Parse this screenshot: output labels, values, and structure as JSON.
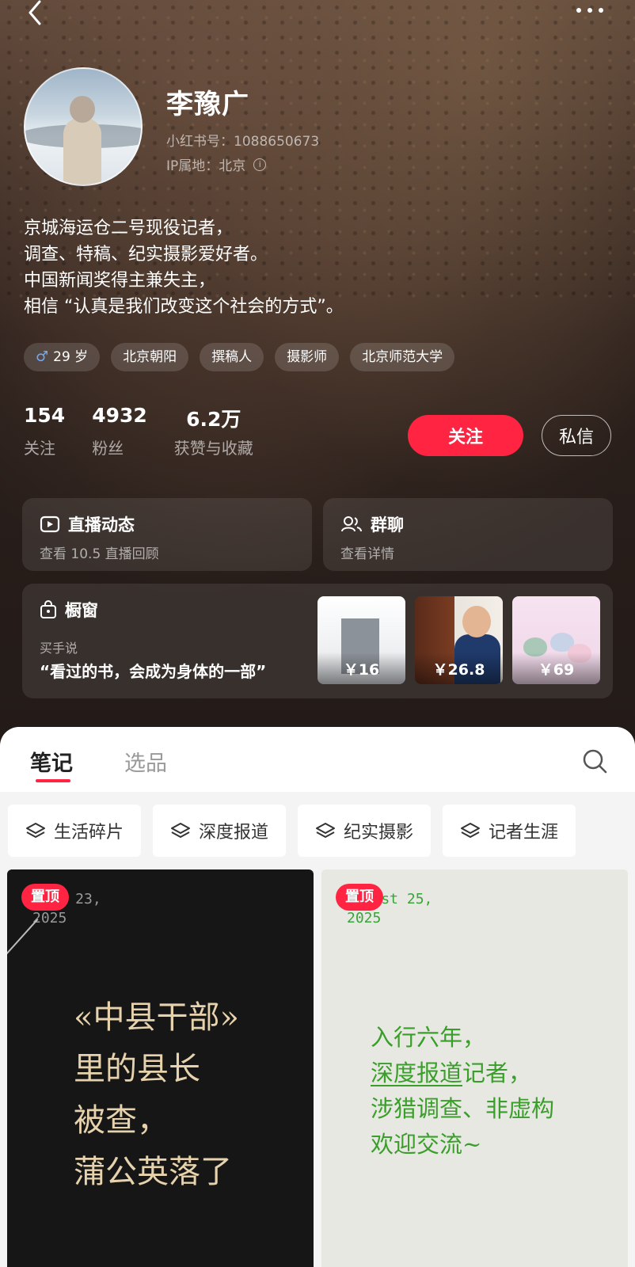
{
  "profile": {
    "name": "李豫广",
    "red_id": "小红书号：1088650673",
    "ip_location": "IP属地：北京",
    "bio_lines": [
      "京城海运仓二号现役记者，",
      "调查、特稿、纪实摄影爱好者。",
      "中国新闻奖得主兼失主，",
      "相信 “认真是我们改变这个社会的方式”。"
    ],
    "tags": [
      "29 岁",
      "北京朝阳",
      "撰稿人",
      "摄影师",
      "北京师范大学"
    ]
  },
  "stats": [
    {
      "value": "154",
      "label": "关注"
    },
    {
      "value": "4932",
      "label": "粉丝"
    },
    {
      "value": "6.2万",
      "label": "获赞与收藏"
    }
  ],
  "actions": {
    "follow": "关注",
    "message": "私信"
  },
  "cards": {
    "live": {
      "title": "直播动态",
      "subtitle": "查看 10.5 直播回顾"
    },
    "group": {
      "title": "群聊",
      "subtitle": "查看详情"
    },
    "shop": {
      "title": "橱窗",
      "subtitle": "买手说",
      "quote": "“看过的书，会成为身体的一部”",
      "products": [
        {
          "price": "￥16"
        },
        {
          "price": "￥26.8"
        },
        {
          "price": "￥69"
        }
      ]
    }
  },
  "tabs": [
    "笔记",
    "选品"
  ],
  "categories": [
    "生活碎片",
    "深度报道",
    "纪实摄影",
    "记者生涯"
  ],
  "notes": [
    {
      "pin": "置顶",
      "date_lines": [
        "   l 23,",
        "2025"
      ],
      "text_lines": [
        "«中县干部»",
        "里的县长",
        "被查，",
        "蒲公英落了"
      ]
    },
    {
      "pin": "置顶",
      "date_lines": [
        "    st 25,",
        "2025"
      ],
      "text_lines": [
        "入行六年，",
        "深度报道",
        "记者，",
        "涉猎调查、非虚构",
        "欢迎交流~"
      ]
    }
  ],
  "colors": {
    "accent": "#ff2442",
    "note_green": "#3a9e2a",
    "note_gold": "#e6d2ac"
  },
  "icons": {
    "back": "chevron-left-icon",
    "more": "more-dots-icon",
    "search": "search-icon",
    "layers": "layers-icon"
  }
}
